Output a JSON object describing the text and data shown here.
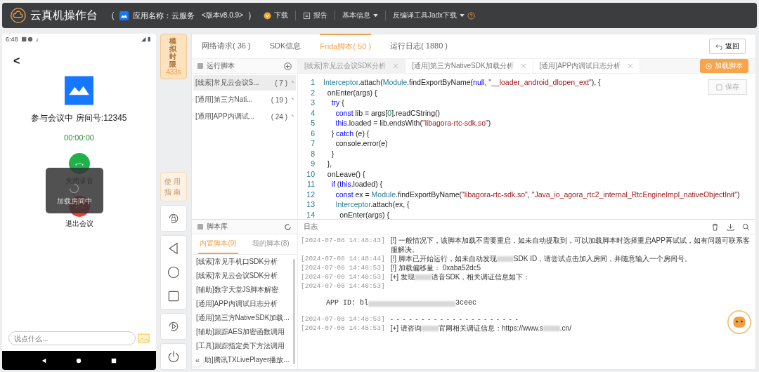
{
  "header": {
    "title": "云真机操作台",
    "open_paren": "（",
    "app_name": "应用名称：云服务",
    "version": "<版本v8.0.9>",
    "close_paren": "）",
    "menu": [
      {
        "label": "下载",
        "kind": "download"
      },
      {
        "label": "报告",
        "kind": "report"
      },
      {
        "label": "基本信息",
        "kind": "dropdown"
      },
      {
        "label": "反编译工具Jadx下载",
        "kind": "help"
      }
    ]
  },
  "phone": {
    "time": "6:48",
    "back": "<",
    "meeting": "参与会议中 房间号:12345",
    "timer": "00:00:00",
    "controls": [
      {
        "label": "关闭录音",
        "kind": "mute"
      },
      {
        "label": "退出会议",
        "kind": "hangup"
      }
    ],
    "loading": "加载房间中",
    "chat_placeholder": "说点什么..."
  },
  "side": {
    "limit_label": "模拟时限",
    "limit_value": "433s",
    "guide": "使用指南"
  },
  "tabs": [
    {
      "label": "网络请求( 36 )",
      "selected": false
    },
    {
      "label": "SDK信息",
      "selected": false
    },
    {
      "label": "Frida脚本( 50 )",
      "selected": true
    },
    {
      "label": "运行日志( 1880 )",
      "selected": false
    }
  ],
  "back_button": "返回",
  "run_scripts": {
    "title": "运行脚本",
    "items": [
      {
        "name": "[线索]常见云会议S...",
        "count": "( 7 )",
        "selected": true
      },
      {
        "name": "[通用]第三方Nati...",
        "count": "( 19 )",
        "selected": false
      },
      {
        "name": "[通用]APP内调试...",
        "count": "( 24 )",
        "selected": false
      }
    ]
  },
  "editor": {
    "tabs": [
      {
        "label": "[线索]常见云会议SDK分析",
        "selected": true
      },
      {
        "label": "[通用]第三方NativeSDK加载分析",
        "selected": false
      },
      {
        "label": "[通用]APP内调试日志分析",
        "selected": false
      }
    ],
    "load_button": "加载脚本",
    "save_button": "保存",
    "lines": [
      {
        "number": "1",
        "tokens": [
          {
            "text": "Interceptor",
            "kind": "cls"
          },
          {
            "text": ".attach(",
            "kind": "plain"
          },
          {
            "text": "Module",
            "kind": "cls"
          },
          {
            "text": ".findExportByName(",
            "kind": "plain"
          },
          {
            "text": "null",
            "kind": "kw"
          },
          {
            "text": ", ",
            "kind": "plain"
          },
          {
            "text": "\"__loader_android_dlopen_ext\"",
            "kind": "str"
          },
          {
            "text": "), {",
            "kind": "plain"
          }
        ]
      },
      {
        "number": "2",
        "tokens": [
          {
            "text": "  onEnter(args) {",
            "kind": "plain"
          }
        ]
      },
      {
        "number": "3",
        "tokens": [
          {
            "text": "    try",
            "kind": "kw"
          },
          {
            "text": " {",
            "kind": "plain"
          }
        ]
      },
      {
        "number": "4",
        "tokens": [
          {
            "text": "      const",
            "kind": "kw"
          },
          {
            "text": " lib = args[",
            "kind": "plain"
          },
          {
            "text": "0",
            "kind": "num"
          },
          {
            "text": "].readCString()",
            "kind": "plain"
          }
        ]
      },
      {
        "number": "5",
        "tokens": [
          {
            "text": "      this",
            "kind": "kw"
          },
          {
            "text": ".loaded = lib.endsWith(",
            "kind": "plain"
          },
          {
            "text": "\"libagora-rtc-sdk.so\"",
            "kind": "str"
          },
          {
            "text": ")",
            "kind": "plain"
          }
        ]
      },
      {
        "number": "6",
        "tokens": [
          {
            "text": "    } ",
            "kind": "plain"
          },
          {
            "text": "catch",
            "kind": "kw"
          },
          {
            "text": " (e) {",
            "kind": "plain"
          }
        ]
      },
      {
        "number": "7",
        "tokens": [
          {
            "text": "      console.error(e)",
            "kind": "plain"
          }
        ]
      },
      {
        "number": "8",
        "tokens": [
          {
            "text": "    }",
            "kind": "plain"
          }
        ]
      },
      {
        "number": "9",
        "tokens": [
          {
            "text": "  },",
            "kind": "plain"
          }
        ]
      },
      {
        "number": "10",
        "tokens": [
          {
            "text": "  onLeave() {",
            "kind": "plain"
          }
        ]
      },
      {
        "number": "11",
        "tokens": [
          {
            "text": "    if",
            "kind": "kw"
          },
          {
            "text": " (",
            "kind": "plain"
          },
          {
            "text": "this",
            "kind": "kw"
          },
          {
            "text": ".loaded) {",
            "kind": "plain"
          }
        ]
      },
      {
        "number": "12",
        "tokens": [
          {
            "text": "      const",
            "kind": "kw"
          },
          {
            "text": " ex = ",
            "kind": "plain"
          },
          {
            "text": "Module",
            "kind": "cls"
          },
          {
            "text": ".findExportByName(",
            "kind": "plain"
          },
          {
            "text": "\"libagora-rtc-sdk.so\"",
            "kind": "str"
          },
          {
            "text": ", ",
            "kind": "plain"
          },
          {
            "text": "\"Java_io_agora_rtc2_internal_RtcEngineImpl_nativeObjectInit\"",
            "kind": "str"
          },
          {
            "text": ")",
            "kind": "plain"
          }
        ]
      },
      {
        "number": "13",
        "tokens": [
          {
            "text": "      Interceptor",
            "kind": "cls"
          },
          {
            "text": ".attach(ex, {",
            "kind": "plain"
          }
        ]
      },
      {
        "number": "14",
        "tokens": [
          {
            "text": "        onEnter(args) {",
            "kind": "plain"
          }
        ]
      }
    ]
  },
  "library": {
    "title": "脚本库",
    "tabs": [
      {
        "label": "内置脚本(9)",
        "selected": true
      },
      {
        "label": "我的脚本(8)",
        "selected": false
      }
    ],
    "items": [
      "[线索]常见手机口SDK分析",
      "[线索]常见云会议SDK分析",
      "[辅助]数字天堂JS脚本解密",
      "[通用]APP内调试日志分析",
      "[通用]第三方NativeSDK加载...",
      "[辅助]跟踪AES加密函数调用",
      "[工具]跟踪指定类下方法调用",
      "助]腾讯TXLivePlayer播放..."
    ],
    "collapse": "«"
  },
  "log": {
    "title": "日志",
    "entries": [
      {
        "time": "[2024-07-08 14:48:43]",
        "parts": [
          "[!] 一般情况下，该脚本加载不需要重启，如未自动提取到，可以加载脚本时选择重启APP再试试，如有问题可联系客服解决。"
        ]
      },
      {
        "time": "[2024-07-08 14:48:44]",
        "parts": [
          "[!] 脚本已开始运行，如未自动发现",
          "SDK ID，请尝试点击加入房间，并随意输入一个房间号。"
        ]
      },
      {
        "time": "[2024-07-08 14:48:53]",
        "parts": [
          "[!] 加载偏移量： 0xaba52dc5"
        ]
      },
      {
        "time": "[2024-07-08 14:48:53]",
        "parts": [
          "[+] 发现",
          "语音SDK，相关调证信息如下："
        ]
      },
      {
        "time": "[2024-07-08 14:48:53]"
      },
      {
        "parts": [
          "APP ID: bl",
          "3ceec"
        ]
      },
      {
        "time": "[2024-07-08 14:48:53]",
        "parts": [
          "-  -  -  -  -  -  -  -  -  -  -  -  -  -  -  -  -  -  -  -  -"
        ]
      },
      {
        "time": "[2024-07-08 14:48:53]",
        "parts": [
          "[+] 请咨询",
          "官网相关调证信息：https://www.s",
          ".cn/"
        ]
      }
    ]
  }
}
